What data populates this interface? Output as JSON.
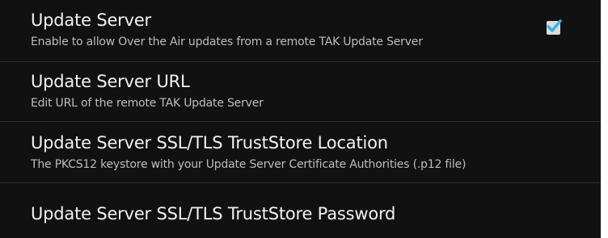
{
  "preferences": [
    {
      "title": "Update Server",
      "summary": "Enable to allow Over the Air updates from a remote TAK Update Server",
      "checked": true
    },
    {
      "title": "Update Server URL",
      "summary": "Edit URL of the remote TAK Update Server"
    },
    {
      "title": "Update Server SSL/TLS TrustStore Location",
      "summary": "The PKCS12 keystore with your Update Server Certificate Authorities (.p12 file)"
    },
    {
      "title": "Update Server SSL/TLS TrustStore Password"
    }
  ],
  "colors": {
    "background": "#111111",
    "title_text": "#f2f2f2",
    "summary_text": "#bdbdbd",
    "checkmark": "#33b5e5"
  },
  "icons": {
    "checkbox": "checked-checkbox-icon"
  }
}
